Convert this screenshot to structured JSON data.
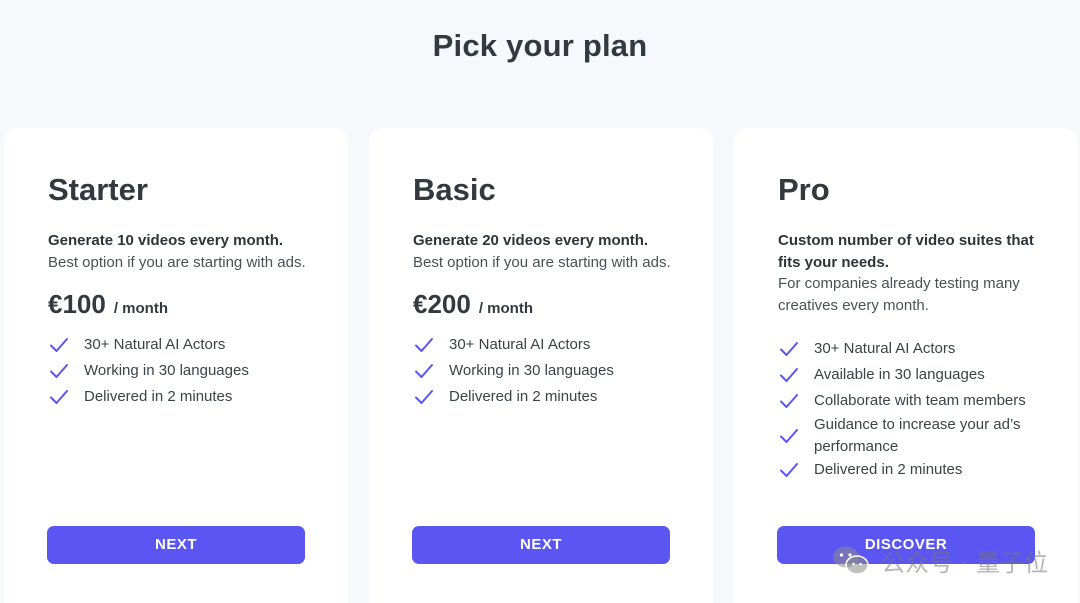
{
  "page": {
    "title": "Pick your plan"
  },
  "colors": {
    "accent": "#5b55f2",
    "check": "#5b55f2",
    "background": "#f6f8fb",
    "card": "#ffffff"
  },
  "plans": [
    {
      "name": "Starter",
      "desc_bold": "Generate 10 videos every month.",
      "desc": "Best option if you are starting with ads.",
      "price": "€100",
      "period": "/ month",
      "features": [
        "30+ Natural AI Actors",
        "Working in 30 languages",
        "Delivered in 2 minutes"
      ],
      "cta": "NEXT"
    },
    {
      "name": "Basic",
      "desc_bold": "Generate 20 videos every month.",
      "desc": "Best option if you are starting with ads.",
      "price": "€200",
      "period": "/ month",
      "features": [
        "30+ Natural AI Actors",
        "Working in 30 languages",
        "Delivered in 2 minutes"
      ],
      "cta": "NEXT"
    },
    {
      "name": "Pro",
      "desc_bold": "Custom number of video suites that fits your needs.",
      "desc": "For companies already testing many creatives every month.",
      "features": [
        "30+ Natural AI Actors",
        "Available in 30 languages",
        "Collaborate with team members",
        "Guidance to increase your ad’s performance",
        "Delivered in 2 minutes"
      ],
      "cta": "DISCOVER"
    }
  ],
  "watermark": {
    "text": "公众号 · 量子位",
    "icon": "wechat-icon"
  }
}
